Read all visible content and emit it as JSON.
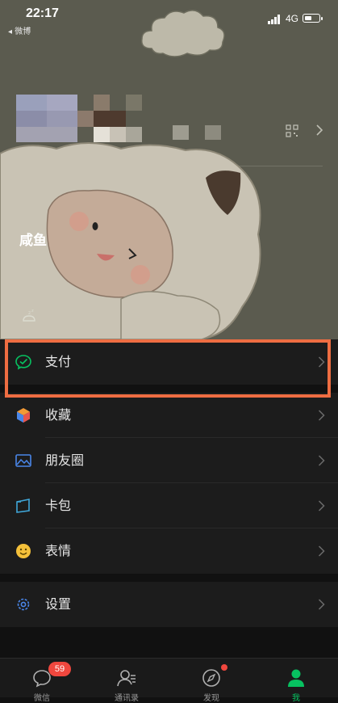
{
  "status_bar": {
    "time": "22:17",
    "back_app": "◂ 微博",
    "network": "4G"
  },
  "profile": {
    "name": "咸鱼"
  },
  "menu": {
    "items": [
      {
        "label": "支付",
        "icon": "wechat-pay-icon"
      },
      {
        "label": "收藏",
        "icon": "favorites-cube-icon"
      },
      {
        "label": "朋友圈",
        "icon": "moments-image-icon"
      },
      {
        "label": "卡包",
        "icon": "card-wallet-icon"
      },
      {
        "label": "表情",
        "icon": "sticker-smile-icon"
      }
    ],
    "settings": {
      "label": "设置",
      "icon": "settings-gear-icon"
    }
  },
  "tabbar": {
    "tabs": [
      {
        "label": "微信",
        "icon": "chat-bubble-icon",
        "badge": "59"
      },
      {
        "label": "通讯录",
        "icon": "contacts-icon"
      },
      {
        "label": "发现",
        "icon": "compass-icon",
        "dot": true
      },
      {
        "label": "我",
        "icon": "me-person-icon",
        "active": true
      }
    ]
  },
  "colors": {
    "accent": "#07c160",
    "highlight": "#ee6d42",
    "badge": "#f0473e",
    "header_bg": "#5b5b4f"
  }
}
